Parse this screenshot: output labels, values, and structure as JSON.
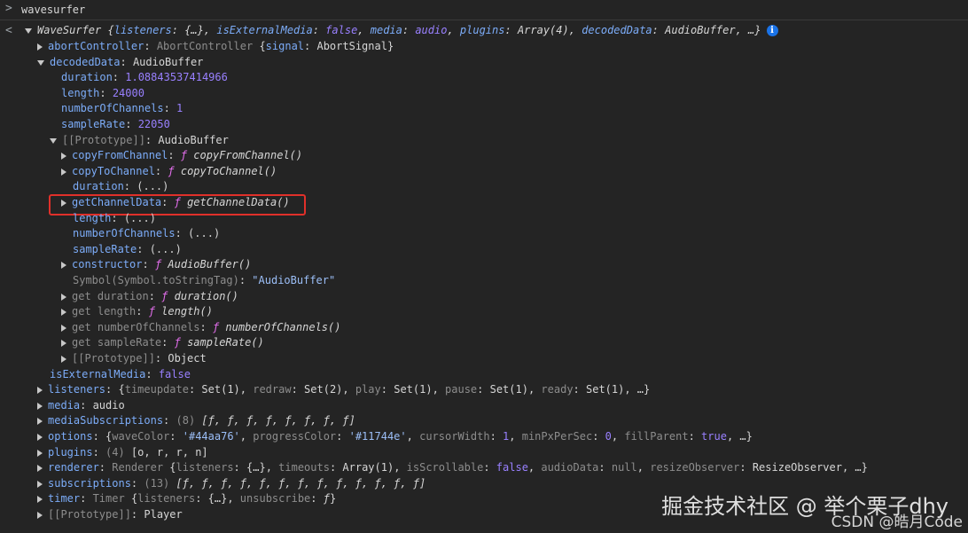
{
  "console": {
    "prompt": ">",
    "command": "wavesurfer",
    "result_prompt": "<"
  },
  "tree": {
    "root_summary": {
      "class": "WaveSurfer",
      "open": "{",
      "k1": "listeners",
      "v1": "{…}",
      "k2": "isExternalMedia",
      "v2": "false",
      "k3": "media",
      "v3": "audio",
      "k4": "plugins",
      "v4": "Array(4)",
      "k5": "decodedData",
      "v5": "AudioBuffer",
      "tail": ", …}",
      "info": "i"
    },
    "abortController": {
      "key": "abortController",
      "type": "AbortController",
      "k": "signal",
      "v": "AbortSignal"
    },
    "decodedData": {
      "key": "decodedData",
      "value": "AudioBuffer"
    },
    "duration": {
      "key": "duration",
      "value": "1.08843537414966"
    },
    "length": {
      "key": "length",
      "value": "24000"
    },
    "numberOfChannels": {
      "key": "numberOfChannels",
      "value": "1"
    },
    "sampleRate": {
      "key": "sampleRate",
      "value": "22050"
    },
    "prototype1": {
      "key": "[[Prototype]]",
      "value": "AudioBuffer"
    },
    "copyFromChannel": {
      "key": "copyFromChannel",
      "f": "ƒ",
      "value": "copyFromChannel()"
    },
    "copyToChannel": {
      "key": "copyToChannel",
      "f": "ƒ",
      "value": "copyToChannel()"
    },
    "durationLazy": {
      "key": "duration",
      "value": "(...)"
    },
    "getChannelData": {
      "key": "getChannelData",
      "f": "ƒ",
      "value": "getChannelData()"
    },
    "lengthLazy": {
      "key": "length",
      "value": "(...)"
    },
    "numberOfChannelsLazy": {
      "key": "numberOfChannels",
      "value": "(...)"
    },
    "sampleRateLazy": {
      "key": "sampleRate",
      "value": "(...)"
    },
    "constructor": {
      "key": "constructor",
      "f": "ƒ",
      "value": "AudioBuffer()"
    },
    "symbolTag": {
      "key": "Symbol(Symbol.toStringTag)",
      "value": "\"AudioBuffer\""
    },
    "getDuration": {
      "key": "get duration",
      "f": "ƒ",
      "value": "duration()"
    },
    "getLength": {
      "key": "get length",
      "f": "ƒ",
      "value": "length()"
    },
    "getNumberOfChannels": {
      "key": "get numberOfChannels",
      "f": "ƒ",
      "value": "numberOfChannels()"
    },
    "getSampleRate": {
      "key": "get sampleRate",
      "f": "ƒ",
      "value": "sampleRate()"
    },
    "prototype2": {
      "key": "[[Prototype]]",
      "value": "Object"
    },
    "isExternalMedia": {
      "key": "isExternalMedia",
      "value": "false"
    },
    "listeners": {
      "key": "listeners",
      "open": "{",
      "k1": "timeupdate",
      "v1": "Set(1)",
      "k2": "redraw",
      "v2": "Set(2)",
      "k3": "play",
      "v3": "Set(1)",
      "k4": "pause",
      "v4": "Set(1)",
      "k5": "ready",
      "v5": "Set(1)",
      "tail": ", …}"
    },
    "media": {
      "key": "media",
      "value": "audio"
    },
    "mediaSubscriptions": {
      "key": "mediaSubscriptions",
      "count": "(8)",
      "value": "[ƒ, ƒ, ƒ, ƒ, ƒ, ƒ, ƒ, ƒ]"
    },
    "options": {
      "key": "options",
      "open": "{",
      "k1": "waveColor",
      "v1": "'#44aa76'",
      "k2": "progressColor",
      "v2": "'#11744e'",
      "k3": "cursorWidth",
      "v3": "1",
      "k4": "minPxPerSec",
      "v4": "0",
      "k5": "fillParent",
      "v5": "true",
      "tail": ", …}"
    },
    "plugins": {
      "key": "plugins",
      "count": "(4)",
      "value": "[o, r, r, n]"
    },
    "renderer": {
      "key": "renderer",
      "type": "Renderer",
      "open": "{",
      "k1": "listeners",
      "v1": "{…}",
      "k2": "timeouts",
      "v2": "Array(1)",
      "k3": "isScrollable",
      "v3": "false",
      "k4": "audioData",
      "v4": "null",
      "k5": "resizeObserver",
      "v5": "ResizeObserver",
      "tail": ", …}"
    },
    "subscriptions": {
      "key": "subscriptions",
      "count": "(13)",
      "value": "[ƒ, ƒ, ƒ, ƒ, ƒ, ƒ, ƒ, ƒ, ƒ, ƒ, ƒ, ƒ, ƒ]"
    },
    "timer": {
      "key": "timer",
      "type": "Timer",
      "k1": "listeners",
      "v1": "{…}",
      "k2": "unsubscribe",
      "v2": "ƒ"
    },
    "prototype3": {
      "key": "[[Prototype]]",
      "value": "Player"
    }
  },
  "watermark": {
    "line1": "掘金技术社区 @ 举个栗子dhy",
    "line2": "CSDN @皓月Code"
  },
  "colors": {
    "background": "#242424",
    "key": "#7cacf8",
    "number": "#9980ff",
    "string": "#f28b54",
    "function": "#e36eec",
    "highlight_box": "#e0302a"
  }
}
